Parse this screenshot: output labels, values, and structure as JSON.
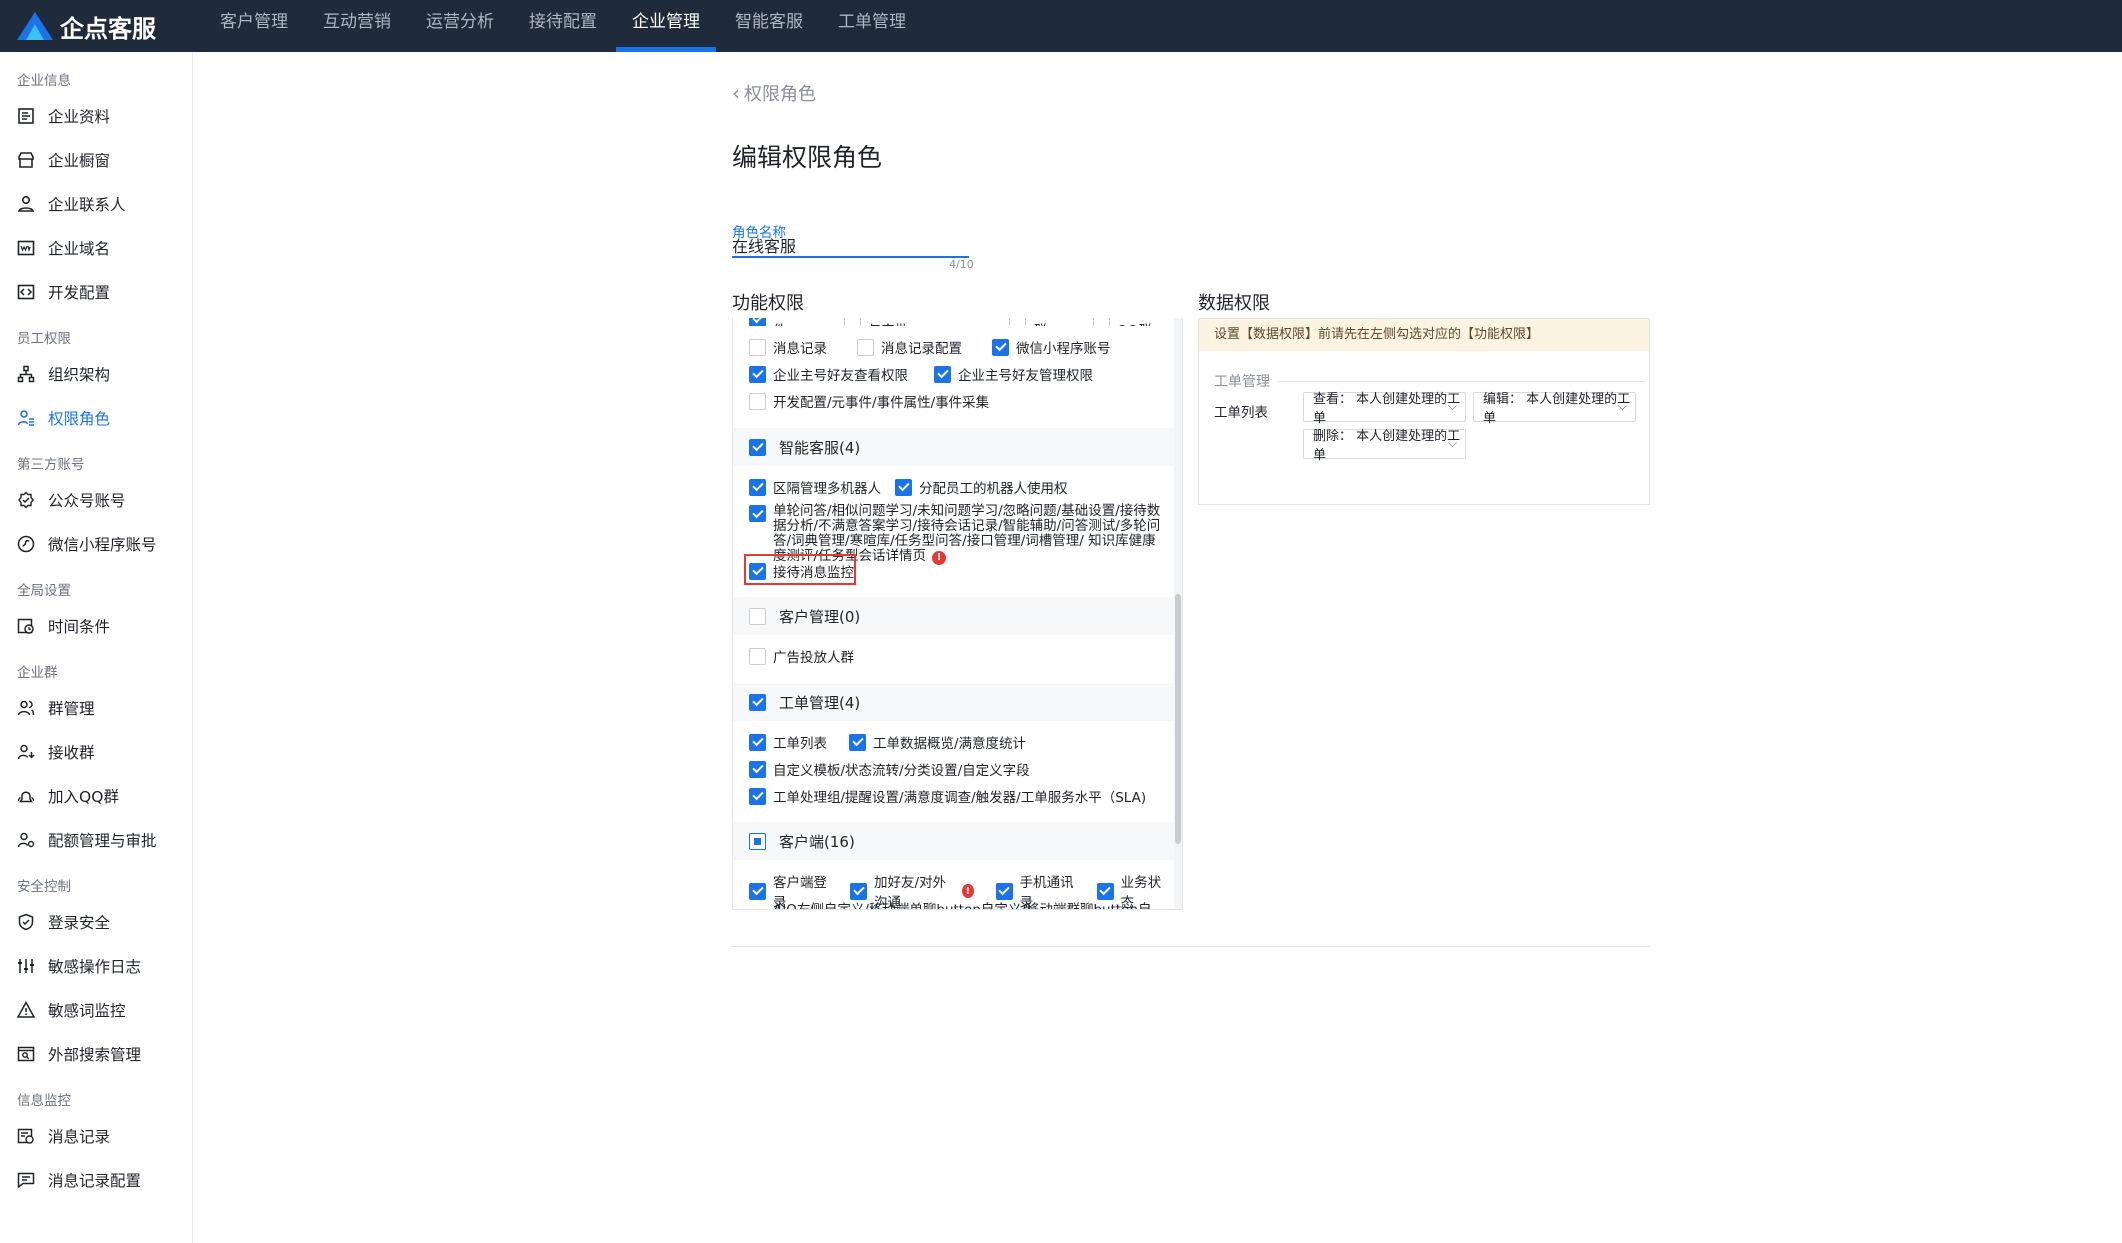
{
  "app": {
    "logo_text": "企点客服"
  },
  "nav": [
    "客户管理",
    "互动营销",
    "运营分析",
    "接待配置",
    "企业管理",
    "智能客服",
    "工单管理"
  ],
  "sidebar": {
    "groups": [
      {
        "title": "企业信息",
        "items": [
          "企业资料",
          "企业橱窗",
          "企业联系人",
          "企业域名",
          "开发配置"
        ]
      },
      {
        "title": "员工权限",
        "items": [
          "组织架构",
          "权限角色"
        ]
      },
      {
        "title": "第三方账号",
        "items": [
          "公众号账号",
          "微信小程序账号"
        ]
      },
      {
        "title": "全局设置",
        "items": [
          "时间条件"
        ]
      },
      {
        "title": "企业群",
        "items": [
          "群管理",
          "接收群",
          "加入QQ群",
          "配额管理与审批"
        ]
      },
      {
        "title": "安全控制",
        "items": [
          "登录安全",
          "敏感操作日志",
          "敏感词监控",
          "外部搜索管理"
        ]
      },
      {
        "title": "信息监控",
        "items": [
          "消息记录",
          "消息记录配置"
        ]
      }
    ]
  },
  "page": {
    "back_label": "权限角色",
    "title": "编辑权限角色",
    "role_name_label": "角色名称",
    "role_name_value": "在线客服",
    "role_name_count": "4/10",
    "func_title": "功能权限",
    "data_title": "数据权限"
  },
  "func": {
    "clipped_row": [
      "时间条件",
      "群管理/配额管理与审批",
      "接收群",
      "加入QQ群"
    ],
    "row1": [
      "消息记录",
      "消息记录配置",
      "微信小程序账号"
    ],
    "row2": [
      "企业主号好友查看权限",
      "企业主号好友管理权限"
    ],
    "row3": [
      "开发配置/元事件/事件属性/事件采集"
    ],
    "group_ai": "智能客服(4)",
    "ai_row1": [
      "区隔管理多机器人",
      "分配员工的机器人使用权"
    ],
    "ai_long": "单轮问答/相似问题学习/未知问题学习/忽略问题/基础设置/接待数据分析/不满意答案学习/接待会话记录/智能辅助/问答测试/多轮问答/词典管理/寒暄库/任务型问答/接口管理/词槽管理/ 知识库健康度测评/任务型会话详情页",
    "ai_monitor": "接待消息监控",
    "group_customer": "客户管理(0)",
    "customer_row": [
      "广告投放人群"
    ],
    "group_ticket": "工单管理(4)",
    "ticket_row1": [
      "工单列表",
      "工单数据概览/满意度统计"
    ],
    "ticket_row2": [
      "自定义模板/状态流转/分类设置/自定义字段"
    ],
    "ticket_row3": [
      "工单处理组/提醒设置/满意度调查/触发器/工单服务水平（SLA)"
    ],
    "group_client": "客户端(16)",
    "client_row1": [
      "客户端登录",
      "加好友/对外沟通",
      "手机通讯录",
      "业务状态"
    ],
    "client_row2": [
      "AIO右侧自定义/移动端单聊button自定义/移动端群聊button自定义"
    ]
  },
  "data_perm": {
    "tip": "设置【数据权限】前请先在左侧勾选对应的【功能权限】",
    "group": "工单管理",
    "label": "工单列表",
    "view": "查看：  本人创建处理的工单",
    "edit": "编辑：  本人创建处理的工单",
    "delete": "删除：  本人创建处理的工单"
  },
  "colors": {
    "accent": "#1a73e8",
    "topbar": "#1f2a3a",
    "warn": "#e53935",
    "tip_bg": "#fdf3e2"
  }
}
